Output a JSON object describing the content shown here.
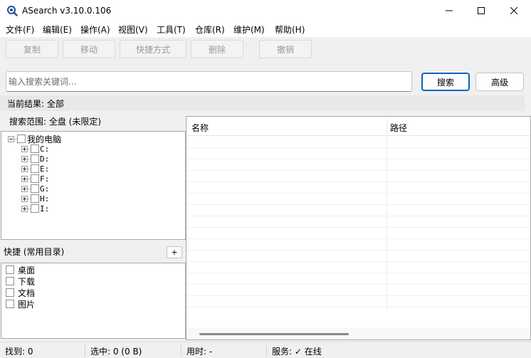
{
  "window": {
    "title": "ASearch v3.10.0.106"
  },
  "menu": [
    "文件(F)",
    "编辑(E)",
    "操作(A)",
    "视图(V)",
    "工具(T)",
    "仓库(R)",
    "维护(M)",
    "帮助(H)"
  ],
  "toolbar": {
    "copy": "复制",
    "move": "移动",
    "shortcut": "快捷方式",
    "delete": "删除",
    "undo": "撤销"
  },
  "search": {
    "placeholder": "输入搜索关键词...",
    "value": "",
    "search_button": "搜索",
    "advanced_button": "高级"
  },
  "result_label": "当前结果: 全部",
  "scope_label": "搜索范围: 全盘 (未限定)",
  "tree": {
    "root": "我的电脑",
    "drives": [
      "C:",
      "D:",
      "E:",
      "F:",
      "G:",
      "H:",
      "I:"
    ]
  },
  "quick": {
    "label": "快捷 (常用目录)",
    "add": "+",
    "items": [
      "桌面",
      "下载",
      "文档",
      "图片"
    ]
  },
  "results": {
    "columns": [
      "名称",
      "路径"
    ]
  },
  "status": {
    "found": "找到: 0",
    "selected": "选中: 0 (0 B)",
    "time": "用时: -",
    "service": "服务: ✓ 在线"
  },
  "colors": {
    "accent": "#0067c0",
    "background": "#f0f0f0"
  }
}
